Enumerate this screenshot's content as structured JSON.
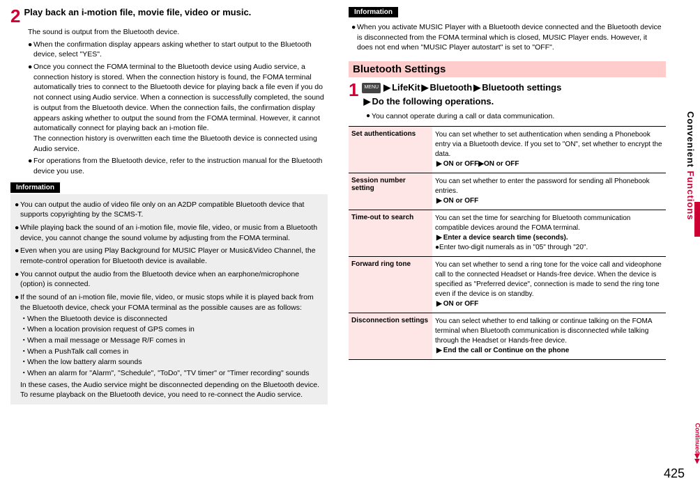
{
  "left": {
    "step_num": "2",
    "step_title": "Play back an i-motion file, movie file, video or music.",
    "intro": "The sound is output from the Bluetooth device.",
    "bullets": [
      "When the confirmation display appears asking whether to start output to the Bluetooth device, select \"YES\".",
      "Once you connect the FOMA terminal to the Bluetooth device using Audio service, a connection history is stored. When the connection history is found, the FOMA terminal automatically tries to connect to the Bluetooth device for playing back a file even if you do not connect using Audio service. When a connection is successfully completed, the sound is output from the Bluetooth device. When the connection fails, the confirmation display appears asking whether to output the sound from the FOMA terminal. However, it cannot automatically connect for playing back an i-motion file.",
      "For operations from the Bluetooth device, refer to the instruction manual for the Bluetooth device you use."
    ],
    "bullets_extra": "The connection history is overwritten each time the Bluetooth device is connected using Audio service.",
    "info_label": "Information",
    "info_items": [
      "You can output the audio of video file only on an A2DP compatible Bluetooth device that supports copyrighting by the SCMS-T.",
      "While playing back the sound of an i-motion file, movie file, video, or music from a Bluetooth device, you cannot change the sound volume by adjusting from the FOMA terminal.",
      "Even when you are using Play Background for MUSIC Player or Music&Video Channel, the remote-control operation for Bluetooth device is available.",
      "You cannot output the audio from the Bluetooth device when an earphone/microphone (option) is connected.",
      "If the sound of an i-motion file, movie file, video, or music stops while it is played back from the Bluetooth device, check your FOMA terminal as the possible causes are as follows:"
    ],
    "causes": [
      "When the Bluetooth device is disconnected",
      "When a location provision request of GPS comes in",
      "When a mail message or Message R/F comes in",
      "When a PushTalk call comes in",
      "When the low battery alarm sounds",
      "When an alarm for \"Alarm\", \"Schedule\", \"ToDo\", \"TV timer\" or \"Timer recording\" sounds"
    ],
    "info_tail": "In these cases, the Audio service might be disconnected depending on the Bluetooth device. To resume playback on the Bluetooth device, you need to re-connect the Audio service."
  },
  "right": {
    "info_label": "Information",
    "info_items": [
      "When you activate MUSIC Player with a Bluetooth device connected and the Bluetooth device is disconnected from the FOMA terminal which is closed, MUSIC Player ends. However, it does not end when \"MUSIC Player autostart\" is set to \"OFF\"."
    ],
    "section_title": "Bluetooth Settings",
    "step_num": "1",
    "menu_label": "MENU",
    "path_parts": [
      "LifeKit",
      "Bluetooth",
      "Bluetooth settings"
    ],
    "path_tail": "Do the following operations.",
    "note": "You cannot operate during a call or data communication.",
    "rows": [
      {
        "label": "Set authentications",
        "desc": "You can set whether to set authentication when sending a Phonebook entry via a Bluetooth device. If you set to \"ON\", set whether to encrypt the data.",
        "cmd": "ON or OFF▶ON or OFF"
      },
      {
        "label": "Session number setting",
        "desc": "You can set whether to enter the password for sending all Phonebook entries.",
        "cmd": "ON or OFF"
      },
      {
        "label": "Time-out to search",
        "desc": "You can set the time for searching for Bluetooth communication compatible devices around the FOMA terminal.",
        "cmd": "Enter a device search time (seconds).",
        "extra": "Enter two-digit numerals as in \"05\" through \"20\"."
      },
      {
        "label": "Forward ring tone",
        "desc": "You can set whether to send a ring tone for the voice call and videophone call to the connected Headset or Hands-free device. When the device is specified as \"Preferred device\", connection is made to send the ring tone even if the device is on standby.",
        "cmd": "ON or OFF"
      },
      {
        "label": "Disconnection settings",
        "desc": "You can select whether to end talking or continue talking on the FOMA terminal when Bluetooth communication is disconnected while talking through the Headset or Hands-free device.",
        "cmd": "End the call or Continue on the phone"
      }
    ]
  },
  "sidebar": {
    "text1": "Convenient ",
    "text2": "Functions"
  },
  "page_number": "425",
  "continued": "Continued"
}
